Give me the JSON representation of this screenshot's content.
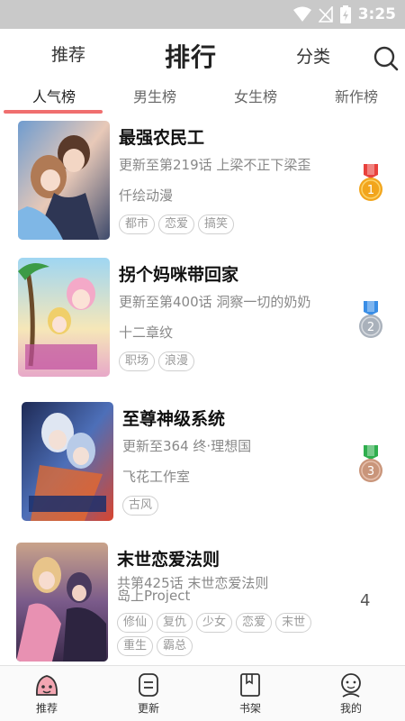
{
  "status": {
    "time": "3:25"
  },
  "topnav": {
    "recommend": "推荐",
    "rank": "排行",
    "category": "分类"
  },
  "subtabs": [
    {
      "label": "人气榜",
      "active": true
    },
    {
      "label": "男生榜",
      "active": false
    },
    {
      "label": "女生榜",
      "active": false
    },
    {
      "label": "新作榜",
      "active": false
    }
  ],
  "items": [
    {
      "title": "最强农民工",
      "update": "更新至第219话 上梁不正下梁歪",
      "author": "仟绘动漫",
      "tags": [
        "都市",
        "恋爱",
        "搞笑"
      ],
      "rank": "1",
      "medal": {
        "ribbon": "#e8413c",
        "disc": "#f2a51c",
        "num": "1"
      }
    },
    {
      "title": "拐个妈咪带回家",
      "update": "更新至第400话 洞察一切的奶奶",
      "author": "十二章纹",
      "tags": [
        "职场",
        "浪漫"
      ],
      "rank": "2",
      "medal": {
        "ribbon": "#3a8ee6",
        "disc": "#a9b1bb",
        "num": "2"
      }
    },
    {
      "title": "至尊神级系统",
      "update": "更新至364 终·理想国",
      "author": "飞花工作室",
      "tags": [
        "古风"
      ],
      "rank": "3",
      "medal": {
        "ribbon": "#2fae4e",
        "disc": "#c9957a",
        "num": "3"
      }
    },
    {
      "title": "末世恋爱法则",
      "update": "共第425话 末世恋爱法则",
      "author": "岛上Project",
      "tags": [
        "修仙",
        "复仇",
        "少女",
        "恋爱",
        "末世",
        "重生",
        "霸总"
      ],
      "rank": "4"
    }
  ],
  "bottomnav": [
    {
      "label": "推荐",
      "icon": "recommend-icon",
      "active": true
    },
    {
      "label": "更新",
      "icon": "update-icon",
      "active": false
    },
    {
      "label": "书架",
      "icon": "bookshelf-icon",
      "active": false
    },
    {
      "label": "我的",
      "icon": "profile-icon",
      "active": false
    }
  ],
  "colors": {
    "accent": "#f06f6f",
    "statusbar": "#c9c9c9"
  }
}
